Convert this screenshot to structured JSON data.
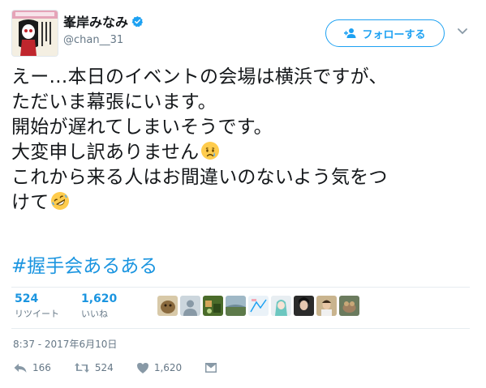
{
  "user": {
    "display_name": "峯岸みなみ",
    "handle": "@chan__31"
  },
  "follow_button": {
    "label": "フォローする"
  },
  "tweet": {
    "lines": [
      "えー…本日のイベントの会場は横浜ですが、",
      "ただいま幕張にいます。",
      "開始が遅れてしまいそうです。",
      "大変申し訳ありません",
      "これから来る人はお間違いのないよう気をつ",
      "けて"
    ],
    "hashtag": "#握手会あるある"
  },
  "stats": {
    "retweets": {
      "count": "524",
      "label": "リツイート"
    },
    "likes": {
      "count": "1,620",
      "label": "いいね"
    }
  },
  "timestamp": "8:37 - 2017年6月10日",
  "actions": {
    "replies": "166",
    "retweets": "524",
    "likes": "1,620"
  },
  "colors": {
    "accent": "#1da1f2",
    "link": "#1b95e0",
    "muted": "#657786"
  },
  "icons": [
    "verified-badge-icon",
    "follow-person-icon",
    "chevron-down-icon",
    "crying-face-emoji",
    "rofl-emoji",
    "reply-icon",
    "retweet-icon",
    "heart-icon",
    "direct-message-icon"
  ]
}
